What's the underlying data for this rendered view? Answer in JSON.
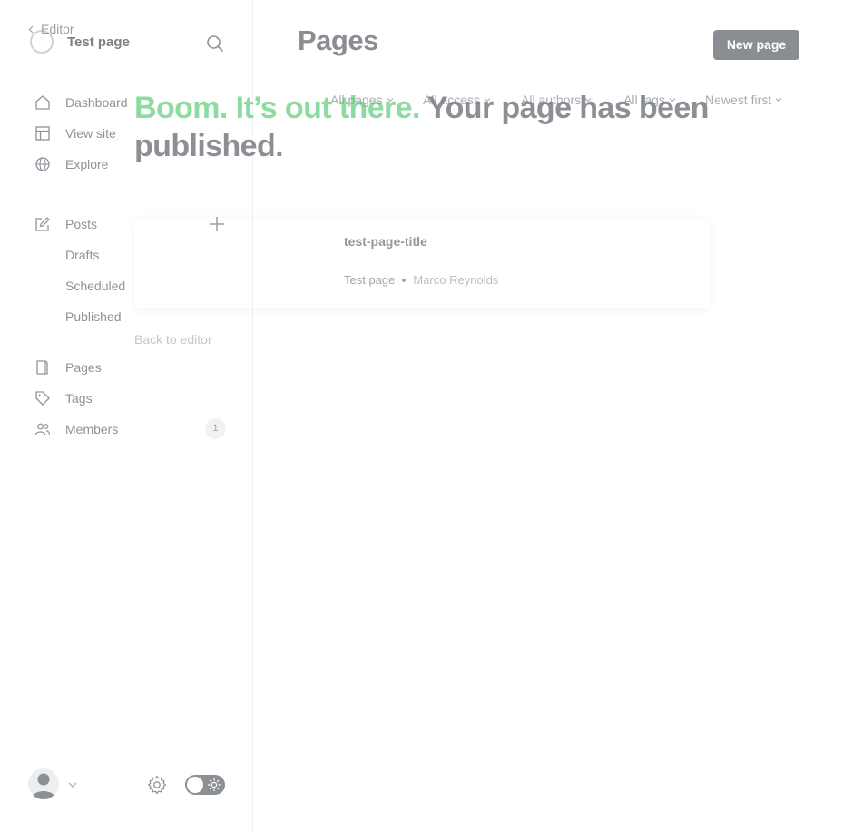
{
  "sidebar": {
    "site_title": "Test page",
    "nav": [
      {
        "label": "Dashboard"
      },
      {
        "label": "View site"
      },
      {
        "label": "Explore"
      }
    ],
    "posts": {
      "label": "Posts",
      "subitems": [
        {
          "label": "Drafts"
        },
        {
          "label": "Scheduled"
        },
        {
          "label": "Published"
        }
      ]
    },
    "nav2": [
      {
        "label": "Pages"
      },
      {
        "label": "Tags"
      },
      {
        "label": "Members",
        "count": "1"
      }
    ]
  },
  "main": {
    "title": "Pages",
    "new_button": "New page",
    "filters": [
      {
        "label": "All pages"
      },
      {
        "label": "All access"
      },
      {
        "label": "All authors"
      },
      {
        "label": "All tags"
      },
      {
        "label": "Newest first"
      }
    ],
    "page_row": {
      "title": "test-page-title",
      "type": "Test page",
      "author": "Marco Reynolds"
    }
  },
  "modal": {
    "back_label": "Editor",
    "heading_accent": "Boom. It’s out there.",
    "heading_rest": " Your page has been published.",
    "back_to_editor": "Back to editor"
  },
  "icons": {
    "search": "search-icon",
    "dashboard": "home-icon",
    "view_site": "layout-icon",
    "explore": "globe-icon",
    "posts": "pencil-square-icon",
    "add": "plus-icon",
    "pages": "page-icon",
    "tags": "tag-icon",
    "members": "users-icon",
    "settings": "gear-icon",
    "theme": "sun-icon"
  },
  "colors": {
    "accent_green": "#30cf43",
    "primary_button": "#15171a"
  }
}
